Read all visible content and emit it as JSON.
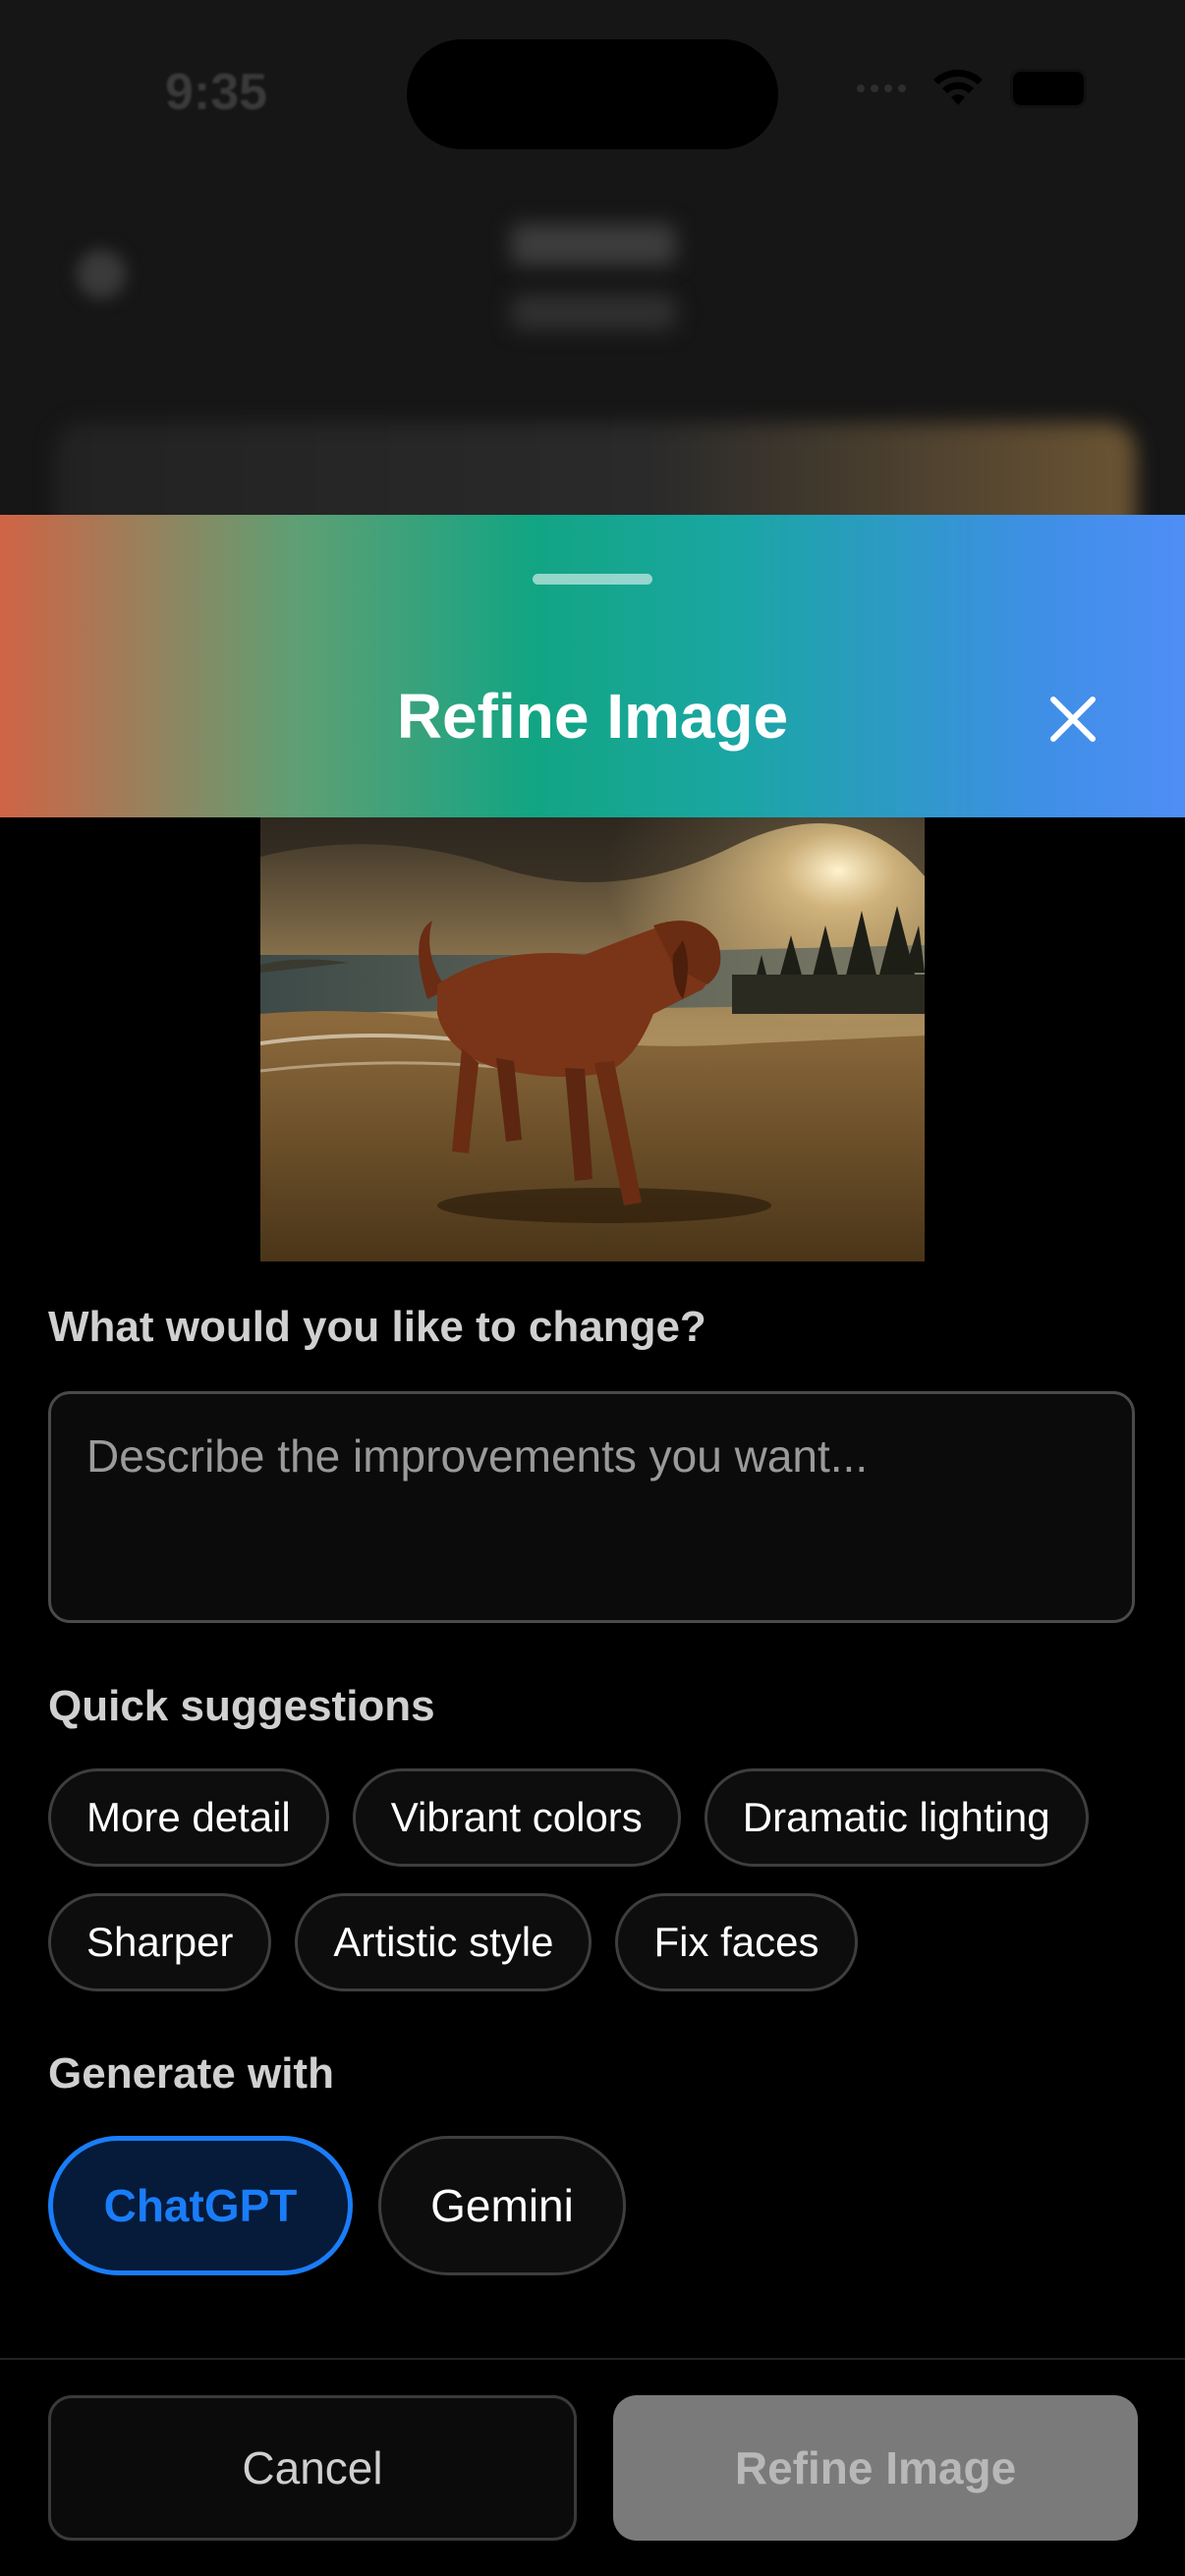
{
  "status_bar": {
    "time": "9:35"
  },
  "sheet": {
    "title": "Refine Image",
    "close_icon": "close-icon",
    "gradient_colors": [
      "#cf6445",
      "#12a583",
      "#4f8ef6"
    ]
  },
  "prompt": {
    "label": "What would you like to change?",
    "placeholder": "Describe the improvements you want...",
    "value": ""
  },
  "suggestions": {
    "label": "Quick suggestions",
    "items": [
      "More detail",
      "Vibrant colors",
      "Dramatic lighting",
      "Sharper",
      "Artistic style",
      "Fix faces"
    ]
  },
  "generate": {
    "label": "Generate with",
    "options": [
      "ChatGPT",
      "Gemini"
    ],
    "selected": "ChatGPT",
    "accent": "#1a7df8"
  },
  "actions": {
    "cancel": "Cancel",
    "refine": "Refine Image"
  }
}
